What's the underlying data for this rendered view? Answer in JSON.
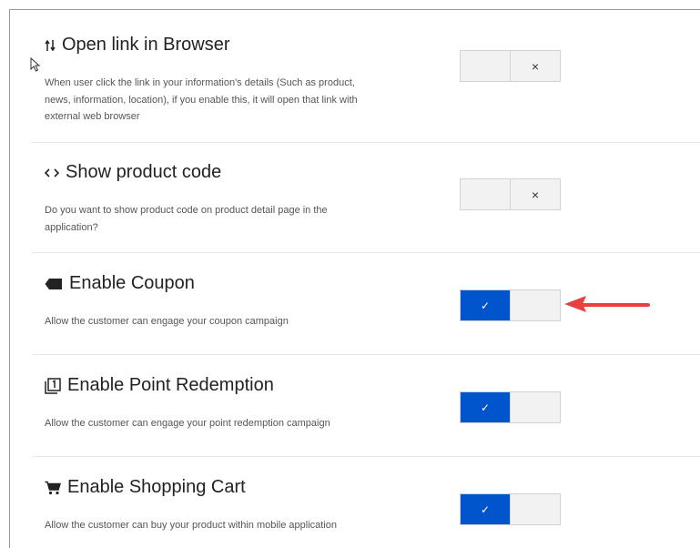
{
  "settings": [
    {
      "title": "Open link in Browser",
      "icon": "sort-arrows-icon",
      "description": "When user click the link in your information's details (Such as product, news, information, location), if you enable this, it will open that link with external web browser",
      "enabled": false,
      "off_glyph": "×"
    },
    {
      "title": "Show product code",
      "icon": "code-brackets-icon",
      "description": "Do you want to show product code on product detail page in the application?",
      "enabled": false,
      "off_glyph": "×"
    },
    {
      "title": "Enable Coupon",
      "icon": "tag-icon",
      "description": "Allow the customer can engage your coupon campaign",
      "enabled": true,
      "on_glyph": "✓"
    },
    {
      "title": "Enable Point Redemption",
      "icon": "redeem-icon",
      "description": "Allow the customer can engage your point redemption campaign",
      "enabled": true,
      "on_glyph": "✓"
    },
    {
      "title": "Enable Shopping Cart",
      "icon": "shopping-cart-icon",
      "description": "Allow the customer can buy your product within mobile application",
      "enabled": true,
      "on_glyph": "✓"
    }
  ],
  "colors": {
    "toggle_on": "#0055cc",
    "toggle_off": "#f2f2f2",
    "annotation_arrow": "#e84040"
  }
}
